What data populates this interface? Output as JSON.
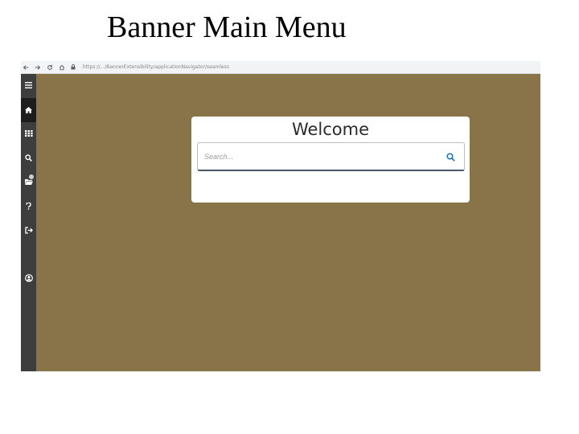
{
  "slide": {
    "title": "Banner Main Menu"
  },
  "browser": {
    "nav_icons": [
      "back-arrow-icon",
      "forward-arrow-icon",
      "reload-icon",
      "home-icon"
    ],
    "url": "https://.../BannerExtensibility/applicationNavigator/seamless"
  },
  "sidebar": {
    "items": [
      {
        "name": "menu-icon"
      },
      {
        "name": "home-icon",
        "active": true
      },
      {
        "name": "applications-grid-icon"
      },
      {
        "name": "search-icon"
      },
      {
        "name": "recently-opened-folder-icon"
      },
      {
        "name": "help-icon"
      },
      {
        "name": "sign-out-icon"
      },
      {
        "name": "user-profile-icon"
      }
    ],
    "background": "#3e3e3e",
    "active_background": "#1d1d1d"
  },
  "main": {
    "background": "#89744a",
    "welcome": {
      "title": "Welcome",
      "search_placeholder": "Search...",
      "search_icon": "search-icon",
      "accent": "#1f6fb5"
    }
  }
}
